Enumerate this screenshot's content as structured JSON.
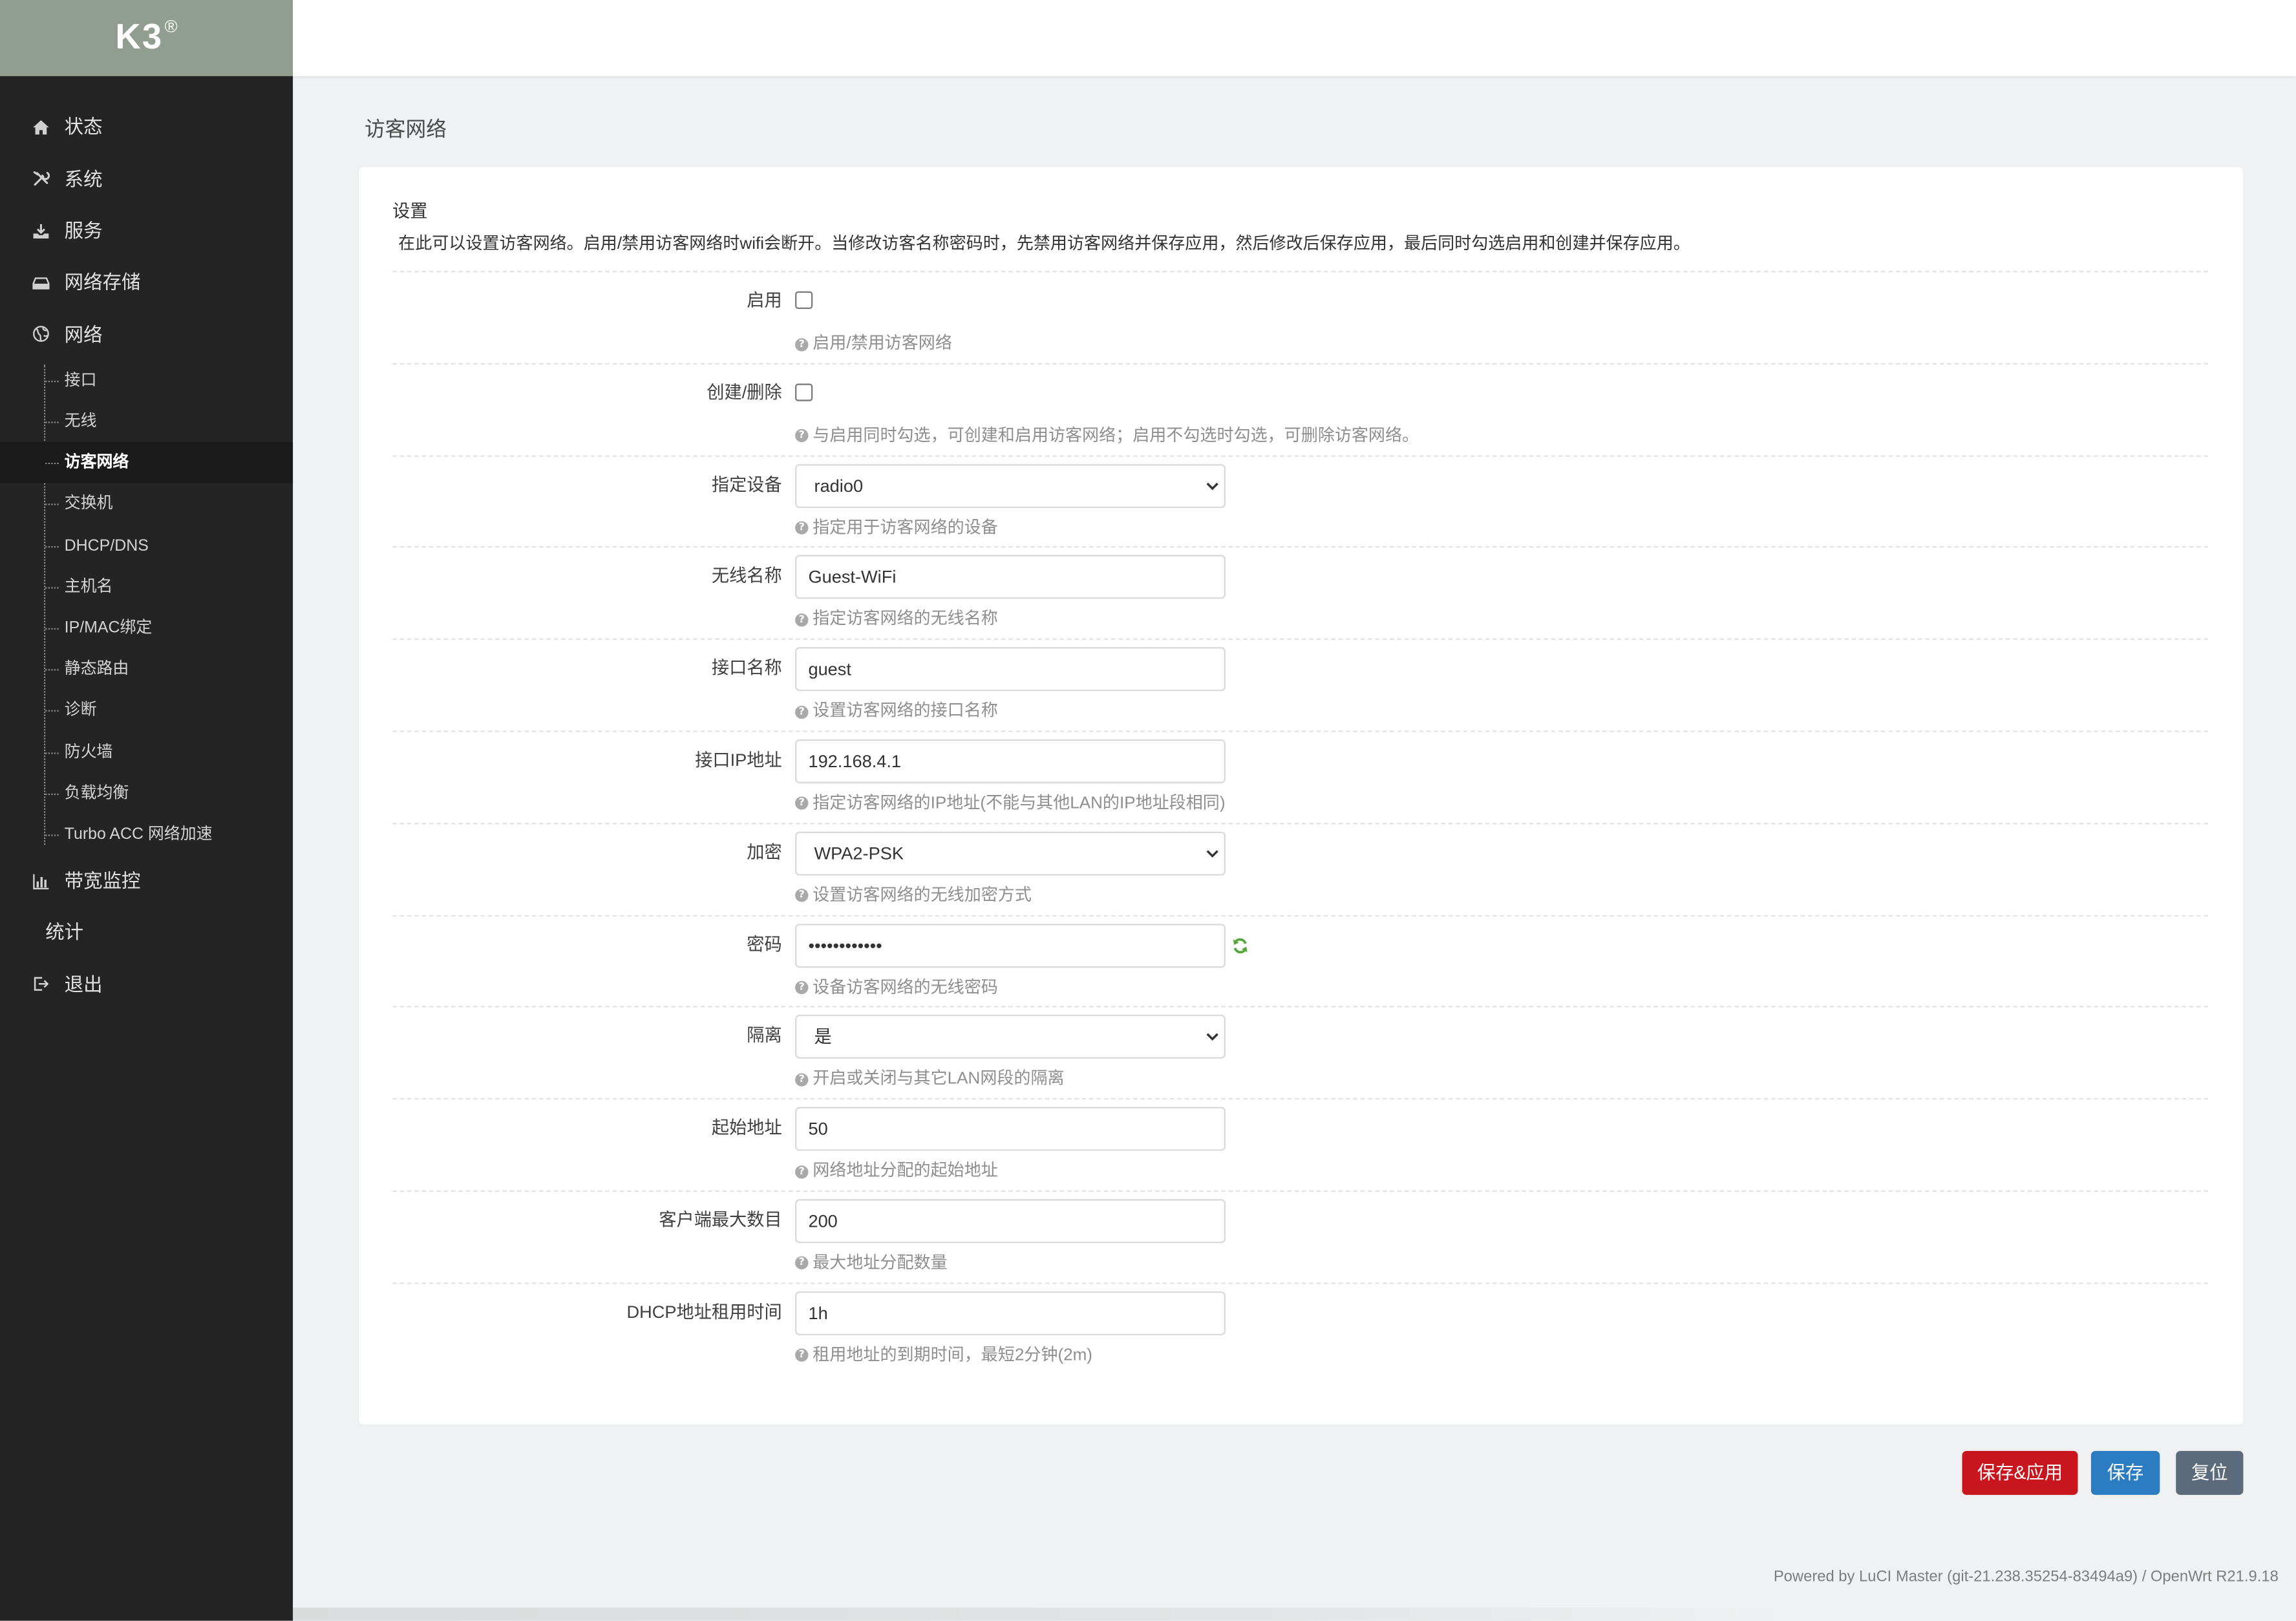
{
  "brand": {
    "logo_text": "K3",
    "logo_mark": "®"
  },
  "sidebar": {
    "items": [
      {
        "label": "状态",
        "icon": "home-icon"
      },
      {
        "label": "系统",
        "icon": "tools-icon"
      },
      {
        "label": "服务",
        "icon": "download-icon"
      },
      {
        "label": "网络存储",
        "icon": "hard-drive-icon"
      },
      {
        "label": "网络",
        "icon": "globe-icon"
      }
    ],
    "network_submenu": [
      {
        "label": "接口"
      },
      {
        "label": "无线"
      },
      {
        "label": "访客网络",
        "active": true
      },
      {
        "label": "交换机"
      },
      {
        "label": "DHCP/DNS"
      },
      {
        "label": "主机名"
      },
      {
        "label": "IP/MAC绑定"
      },
      {
        "label": "静态路由"
      },
      {
        "label": "诊断"
      },
      {
        "label": "防火墙"
      },
      {
        "label": "负载均衡"
      },
      {
        "label": "Turbo ACC 网络加速"
      }
    ],
    "bottom_items": [
      {
        "label": "带宽监控",
        "icon": "bar-chart-icon"
      },
      {
        "label": "统计"
      },
      {
        "label": "退出",
        "icon": "logout-icon"
      }
    ]
  },
  "page": {
    "title": "访客网络"
  },
  "form": {
    "section_title": "设置",
    "description": "在此可以设置访客网络。启用/禁用访客网络时wifi会断开。当修改访客名称密码时，先禁用访客网络并保存应用，然后修改后保存应用，最后同时勾选启用和创建并保存应用。",
    "fields": [
      {
        "label": "启用",
        "checked": false,
        "hint": "启用/禁用访客网络"
      },
      {
        "label": "创建/删除",
        "checked": false,
        "hint": "与启用同时勾选，可创建和启用访客网络；启用不勾选时勾选，可删除访客网络。"
      },
      {
        "label": "指定设备",
        "value": "radio0",
        "hint": "指定用于访客网络的设备"
      },
      {
        "label": "无线名称",
        "value": "Guest-WiFi",
        "hint": "指定访客网络的无线名称"
      },
      {
        "label": "接口名称",
        "value": "guest",
        "hint": "设置访客网络的接口名称"
      },
      {
        "label": "接口IP地址",
        "value": "192.168.4.1",
        "hint": "指定访客网络的IP地址(不能与其他LAN的IP地址段相同)"
      },
      {
        "label": "加密",
        "value": "WPA2-PSK",
        "hint": "设置访客网络的无线加密方式"
      },
      {
        "label": "密码",
        "value": "••••••••••••",
        "hint": "设备访客网络的无线密码",
        "icon": "refresh-icon"
      },
      {
        "label": "隔离",
        "value": "是",
        "hint": "开启或关闭与其它LAN网段的隔离"
      },
      {
        "label": "起始地址",
        "value": "50",
        "hint": "网络地址分配的起始地址"
      },
      {
        "label": "客户端最大数目",
        "value": "200",
        "hint": "最大地址分配数量"
      },
      {
        "label": "DHCP地址租用时间",
        "value": "1h",
        "hint": "租用地址的到期时间，最短2分钟(2m)"
      }
    ]
  },
  "actions": {
    "save_apply": "保存&应用",
    "save": "保存",
    "reset": "复位"
  },
  "footer": {
    "powered_by": "Powered by LuCI Master (git-21.238.35254-83494a9) / OpenWrt R21.9.18"
  },
  "colors": {
    "logo_bg": "#919d90",
    "sidebar_bg": "#242424",
    "save_apply": "#c9151e",
    "save": "#2b7cc0",
    "reset": "#5b6b7c",
    "refresh_icon": "#55a63a"
  }
}
